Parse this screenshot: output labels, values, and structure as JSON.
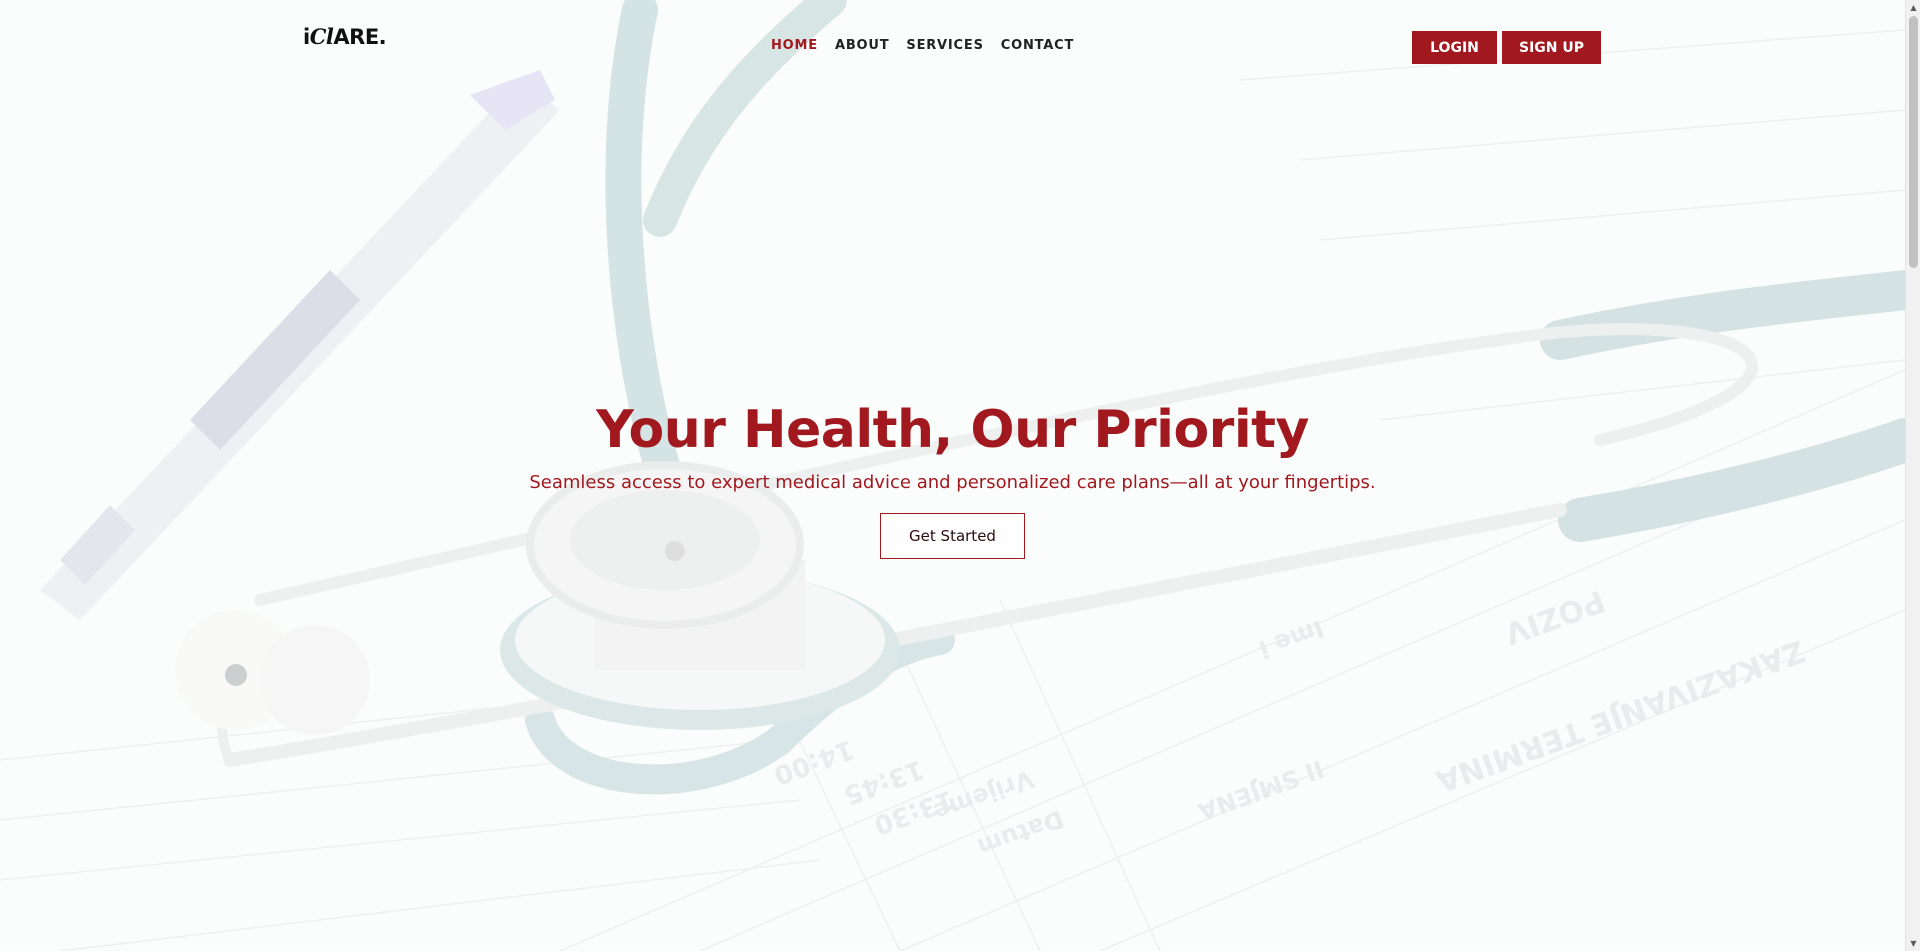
{
  "brand": {
    "logo_text_a": "i",
    "logo_text_b": "Cl",
    "logo_text_c": "ARE."
  },
  "nav": {
    "items": [
      {
        "label": "HOME",
        "active": true
      },
      {
        "label": "ABOUT",
        "active": false
      },
      {
        "label": "SERVICES",
        "active": false
      },
      {
        "label": "CONTACT",
        "active": false
      }
    ]
  },
  "auth": {
    "login_label": "LOGIN",
    "signup_label": "SIGN UP"
  },
  "hero": {
    "title": "Your Health, Our Priority",
    "subtitle": "Seamless access to expert medical advice and personalized care plans—all at your fingertips.",
    "cta_label": "Get Started"
  },
  "background": {
    "subject": "stethoscope-and-pen-on-medical-form",
    "form_text": [
      "14:00",
      "13:45",
      "13:30",
      "Vrijeme",
      "Datum",
      "POZIV",
      "ZAKAZIVANJE TERMINA",
      "Ime i",
      "II SMJENA"
    ]
  },
  "colors": {
    "accent": "#a1191f",
    "nav_text": "#222222",
    "button_text": "#ffffff"
  }
}
